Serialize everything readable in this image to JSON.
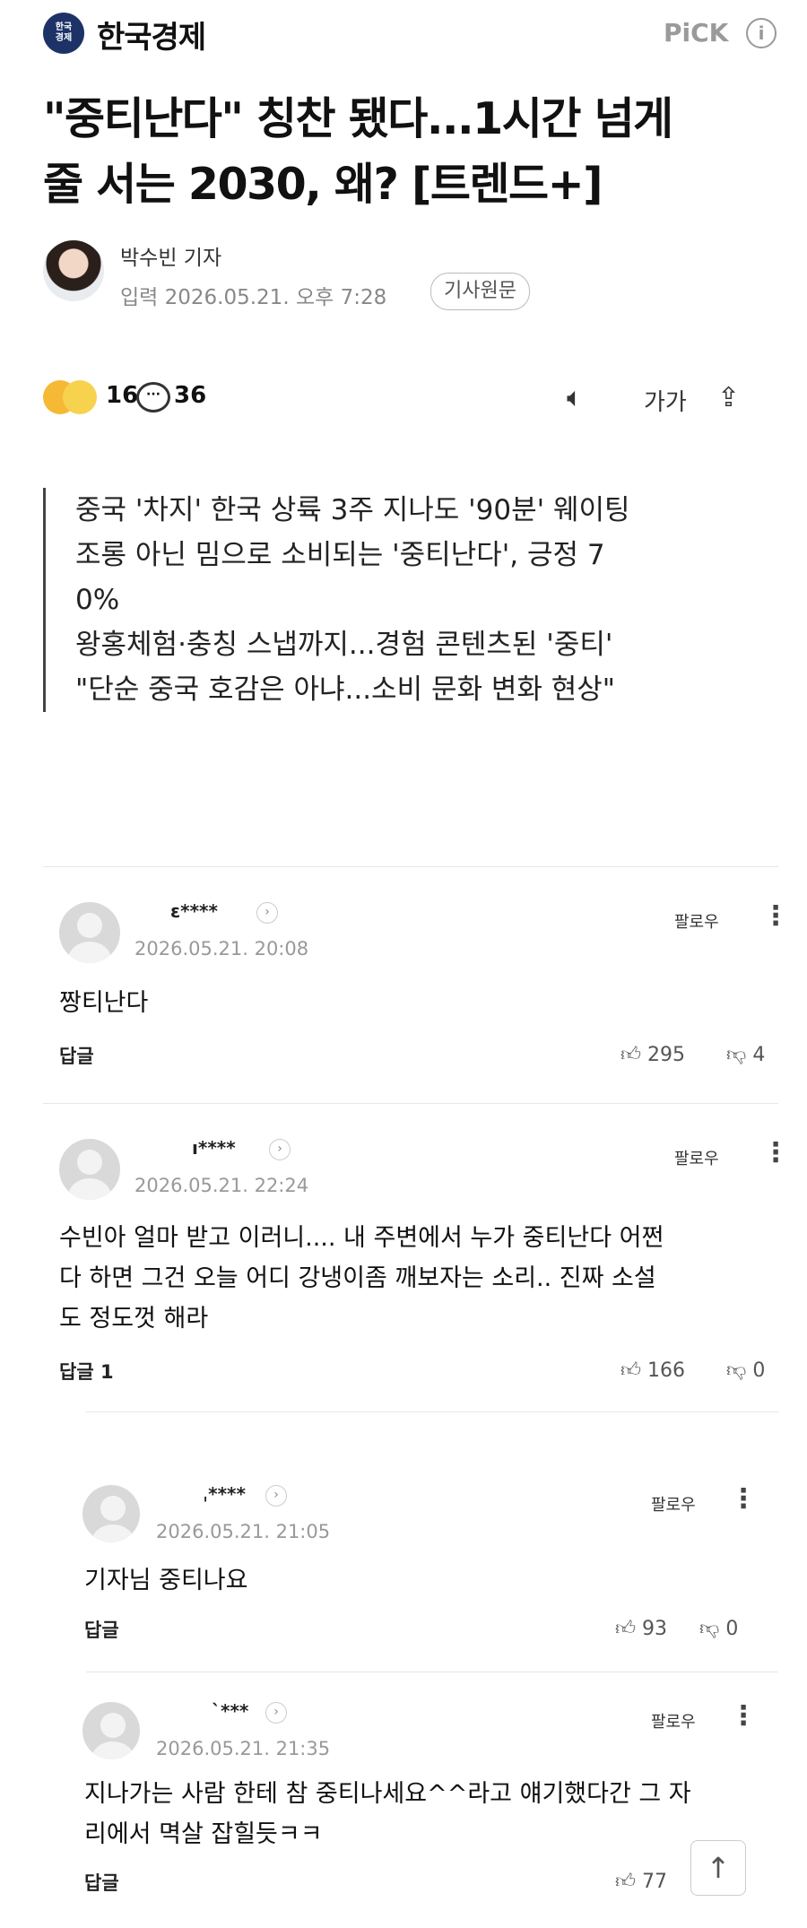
{
  "header": {
    "logo_text": "한국\n경제",
    "brand": "한국경제",
    "pick": "PiCK",
    "info_icon": "ⓘ"
  },
  "article": {
    "title_line1": "\"중티난다\" 칭찬 됐다...1시간 넘게",
    "title_line2": "줄 서는 2030, 왜? [트렌드+]",
    "author": "박수빈 기자",
    "meta": "입력 2026.05.21. 오후 7:28",
    "original_button": "기사원문",
    "reaction_count": "16",
    "comment_count": "36",
    "font_size_label": "가가",
    "summary": [
      "중국 '차지' 한국 상륙 3주 지나도 '90분' 웨이팅",
      "조롱 아닌 밈으로 소비되는 '중티난다', 긍정 7",
      "0%",
      "왕홍체험·충칭 스냅까지...경험 콘텐츠된 '중티'",
      "\"단순 중국 호감은 아냐...소비 문화 변화 현상\""
    ]
  },
  "comments": [
    {
      "user": "ɛ****",
      "date": "2026.05.21. 20:08",
      "follow": "팔로우",
      "body": "짱티난다",
      "reply": "답글",
      "likes": "295",
      "dislikes": "4"
    },
    {
      "user": "ı****",
      "date": "2026.05.21. 22:24",
      "follow": "팔로우",
      "body": "수빈아 얼마 받고 이러니.... 내 주변에서 누가 중티난다 어쩐\n다 하면 그건 오늘 어디 강냉이좀 깨보자는 소리.. 진짜 소설\n도 정도껏 해라",
      "reply": "답글 1",
      "likes": "166",
      "dislikes": "0"
    },
    {
      "user": "ˌ****",
      "date": "2026.05.21. 21:05",
      "follow": "팔로우",
      "body": "기자님 중티나요",
      "reply": "답글",
      "likes": "93",
      "dislikes": "0"
    },
    {
      "user": "`***",
      "date": "2026.05.21. 21:35",
      "follow": "팔로우",
      "body": "지나가는 사람 한테 참 중티나세요^^라고 얘기했다간 그 자\n리에서 멱살 잡힐듯ㅋㅋ",
      "reply": "답글",
      "likes": "77",
      "dislikes": ""
    }
  ],
  "icons": {
    "comment": "comment-bubble-icon",
    "speaker": "speaker-icon",
    "share": "share-icon",
    "like": "thumbs-up-icon",
    "dislike": "thumbs-down-icon",
    "scroll_top": "scroll-top-icon"
  },
  "colors": {
    "brand_navy": "#1d3367",
    "meta_gray": "#888888"
  }
}
